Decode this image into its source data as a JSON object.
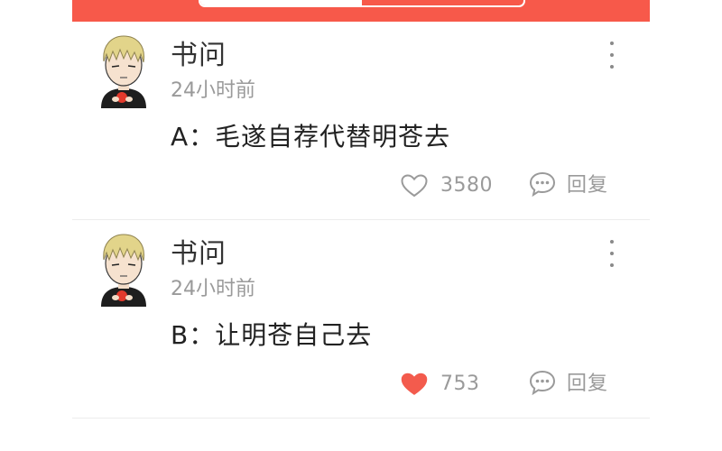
{
  "header": {
    "accent_color": "#f7594a"
  },
  "comments": [
    {
      "username": "书问",
      "timestamp": "24小时前",
      "text": "A：毛遂自荐代替明苍去",
      "likes": "3580",
      "liked": false,
      "like_icon": "heart-outline-icon",
      "reply_label": "回复",
      "reply_icon": "comment-bubble-icon",
      "more_icon": "more-vertical-icon"
    },
    {
      "username": "书问",
      "timestamp": "24小时前",
      "text": "B：让明苍自己去",
      "likes": "753",
      "liked": true,
      "like_icon": "heart-filled-icon",
      "reply_label": "回复",
      "reply_icon": "comment-bubble-icon",
      "more_icon": "more-vertical-icon"
    }
  ],
  "colors": {
    "liked_heart": "#f35b4d",
    "muted_text": "#9a9a9a",
    "primary_text": "#222222"
  }
}
